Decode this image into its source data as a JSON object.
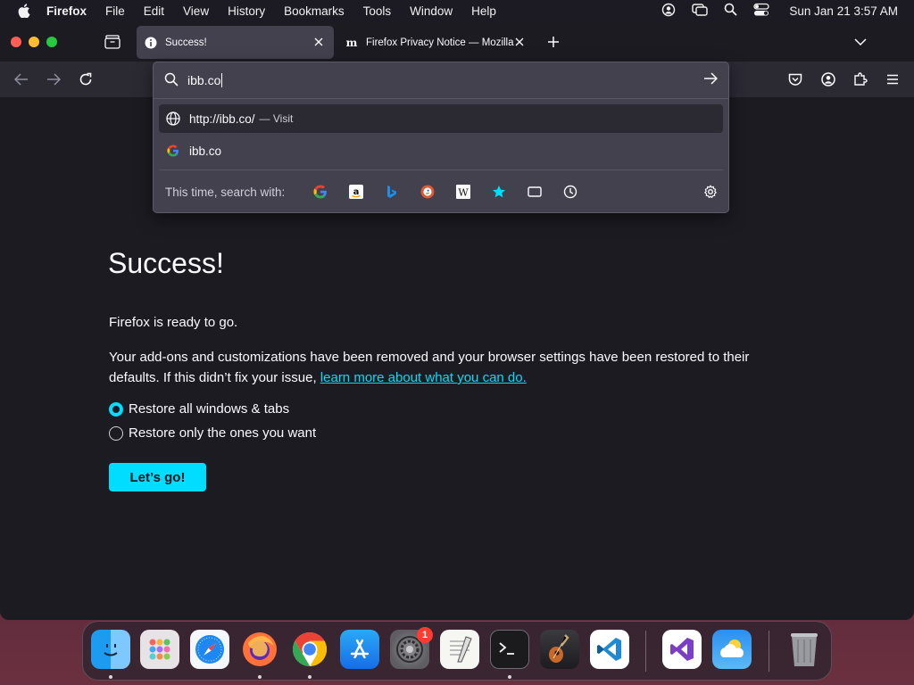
{
  "menubar": {
    "app": "Firefox",
    "items": [
      "File",
      "Edit",
      "View",
      "History",
      "Bookmarks",
      "Tools",
      "Window",
      "Help"
    ],
    "clock": "Sun Jan 21  3:57 AM",
    "status_icons": [
      "user-account-icon",
      "screen-mirroring-icon",
      "spotlight-search-icon",
      "control-center-icon"
    ]
  },
  "tabs": [
    {
      "title": "Success!",
      "active": true,
      "icon": "info-icon"
    },
    {
      "title": "Firefox Privacy Notice — Mozilla",
      "active": false,
      "icon": "mozilla-m-icon"
    }
  ],
  "urlbar": {
    "value": "ibb.co",
    "results": [
      {
        "title": "http://ibb.co/",
        "action": "Visit",
        "icon": "globe-icon"
      },
      {
        "title": "ibb.co",
        "icon": "google-icon"
      }
    ],
    "oneoff_label": "This time, search with:",
    "engines": [
      "google-icon",
      "amazon-icon",
      "bing-icon",
      "duckduckgo-icon",
      "wikipedia-icon",
      "bookmarks-star-icon",
      "tabs-icon",
      "history-icon"
    ]
  },
  "page": {
    "title": "Success!",
    "ready": "Firefox is ready to go.",
    "desc": "Your add-ons and customizations have been removed and your browser settings have been restored to their defaults. If this didn’t fix your issue,",
    "link": "learn more about what you can do.",
    "options": [
      "Restore all windows & tabs",
      "Restore only the ones you want"
    ],
    "selected_option": 0,
    "button": "Let’s go!"
  },
  "dock": {
    "apps": [
      "Finder",
      "Launchpad",
      "Safari",
      "Firefox",
      "Chrome",
      "App Store",
      "System Settings",
      "TextEdit",
      "Terminal",
      "GarageBand",
      "VS Code",
      "Visual Studio",
      "Weather",
      "Trash"
    ],
    "settings_badge": "1"
  },
  "colors": {
    "accent": "#00ddff",
    "page_bg": "#1c1b22",
    "panel_bg": "#42414d",
    "toolbar_bg": "#2b2a33"
  }
}
